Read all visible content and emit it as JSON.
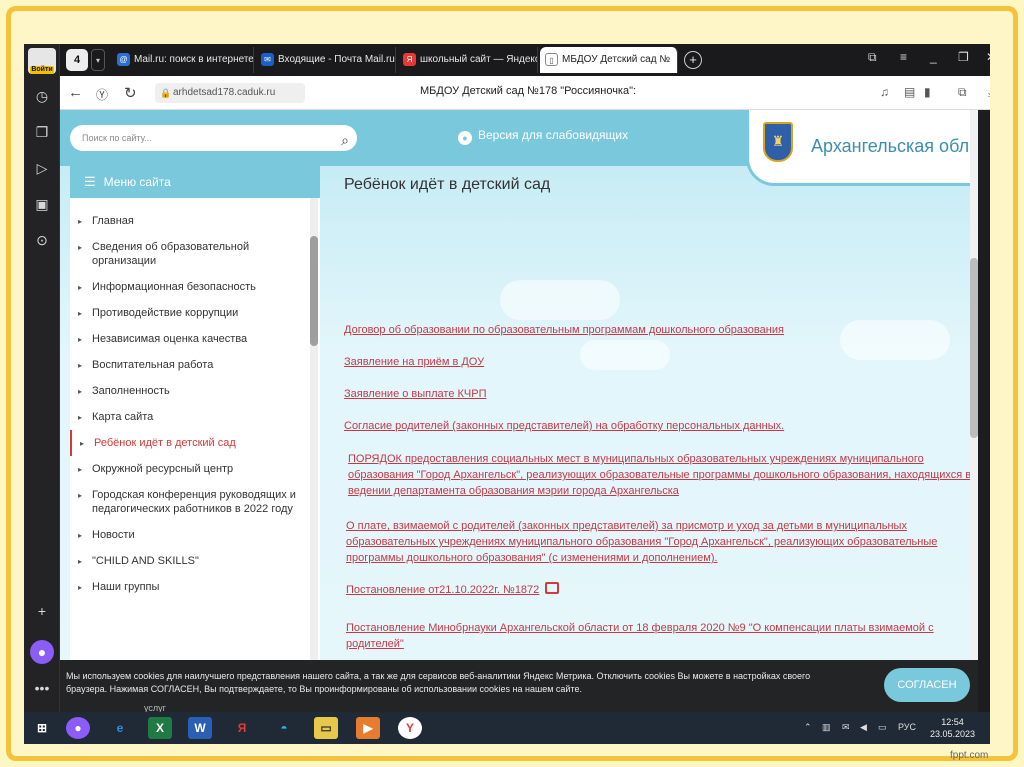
{
  "browser": {
    "yandex_badge": "Войти",
    "tab_count": "4",
    "tabs": [
      {
        "title": "Mail.ru: поиск в интернете",
        "icon_color": "#2b6fd1"
      },
      {
        "title": "Входящие - Почта Mail.ru",
        "icon_color": "#1b5fc7"
      },
      {
        "title": "школьный сайт — Яндекс",
        "icon_color": "#e53935"
      },
      {
        "title": "МБДОУ Детский сад №",
        "icon_color": "#ffffff"
      }
    ],
    "url": "arhdetsad178.caduk.ru",
    "page_title": "МБДОУ Детский сад №178 \"Россияночка\":"
  },
  "site": {
    "search_placeholder": "Поиск по сайту...",
    "low_vision": "Версия для слабовидящих",
    "region": "Архангельская обл."
  },
  "sidebar": {
    "header": "Меню сайта",
    "items": [
      {
        "label": "Главная"
      },
      {
        "label": "Сведения об образовательной организации"
      },
      {
        "label": "Информационная безопасность"
      },
      {
        "label": "Противодействие коррупции"
      },
      {
        "label": "Независимая оценка качества"
      },
      {
        "label": "Воспитательная работа"
      },
      {
        "label": "Заполненность"
      },
      {
        "label": "Карта сайта"
      },
      {
        "label": "Ребёнок идёт в детский сад"
      },
      {
        "label": "Окружной ресурсный центр"
      },
      {
        "label": "Городская конференция руководящих и педагогических работников в 2022 году"
      },
      {
        "label": "Новости"
      },
      {
        "label": "\"CHILD AND SKILLS\""
      },
      {
        "label": "Наши группы"
      }
    ]
  },
  "content": {
    "heading": "Ребёнок идёт в детский сад",
    "links": [
      "Договор об образовании по образовательным программам дошкольного образования",
      "Заявление на приём в ДОУ",
      "Заявление о выплате КЧРП",
      "Согласие родителей (законных представителей) на обработку персональных данных.",
      "ПОРЯДОК предоставления социальных мест в муниципальных образовательных учреждениях муниципального образования \"Город Архангельск\", реализующих образовательные программы дошкольного образования, находящихся в ведении департамента образования мэрии города Архангельска",
      "О плате, взимаемой с родителей (законных представителей) за присмотр и уход за детьми в муниципальных образовательных учреждениях муниципального образования \"Город Архангельск\", реализующих образовательные программы дошкольного образования\" (с изменениями и дополнением).",
      "Постановление от21.10.2022г. №1872",
      "Постановление Минобрнауки Архангельской области от 18 февраля 2020 №9 \"О компенсации платы взимаемой с родителей\""
    ]
  },
  "cookie": {
    "text": "Мы используем cookies для наилучшего представления нашего сайта, а так же для сервисов веб-аналитики Яндекс Метрика. Отключить cookies Вы можете в настройках своего браузера. Нажимая СОГЛАСЕН, Вы подтверждаете, то Вы проинформированы об использовании cookies на нашем сайте.",
    "button": "СОГЛАСЕН",
    "peek": "услуг"
  },
  "taskbar": {
    "lang": "РУС",
    "time": "12:54",
    "date": "23.05.2023"
  },
  "watermark": "fppt.com"
}
